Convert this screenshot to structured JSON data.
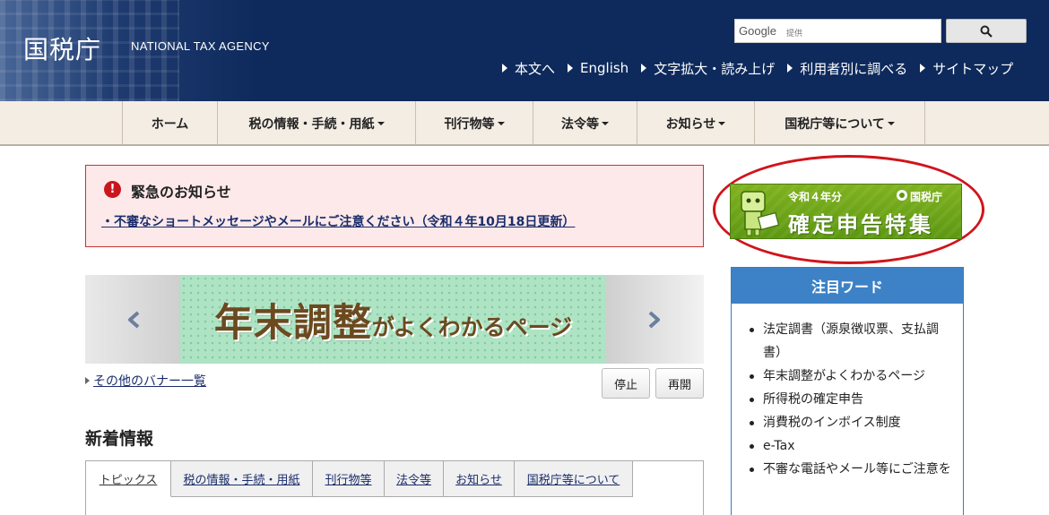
{
  "header": {
    "logo_jp": "国税庁",
    "logo_en": "NATIONAL TAX AGENCY",
    "search": {
      "brand": "Google",
      "brand_sub": "提供",
      "placeholder": "",
      "button_icon": "search-icon"
    },
    "utility_links": [
      {
        "label": "本文へ"
      },
      {
        "label": "English"
      },
      {
        "label": "文字拡大・読み上げ"
      },
      {
        "label": "利用者別に調べる"
      },
      {
        "label": "サイトマップ"
      }
    ]
  },
  "nav": {
    "items": [
      {
        "label": "ホーム",
        "has_dropdown": false
      },
      {
        "label": "税の情報・手続・用紙",
        "has_dropdown": true
      },
      {
        "label": "刊行物等",
        "has_dropdown": true
      },
      {
        "label": "法令等",
        "has_dropdown": true
      },
      {
        "label": "お知らせ",
        "has_dropdown": true
      },
      {
        "label": "国税庁等について",
        "has_dropdown": true
      }
    ]
  },
  "emergency": {
    "icon": "!",
    "title": "緊急のお知らせ",
    "link": "・不審なショートメッセージやメールにご注意ください（令和４年10月18日更新）"
  },
  "kakutei_banner": {
    "year": "令和４年分",
    "agency": "国税庁",
    "title": "確定申告特集"
  },
  "carousel": {
    "banner_main": "年末調整",
    "banner_sub": "がよくわかるページ",
    "other_banners_link": "その他のバナー一覧",
    "stop_label": "停止",
    "resume_label": "再開"
  },
  "news": {
    "title": "新着情報",
    "tabs": [
      {
        "label": "トピックス",
        "active": true
      },
      {
        "label": "税の情報・手続・用紙",
        "active": false
      },
      {
        "label": "刊行物等",
        "active": false
      },
      {
        "label": "法令等",
        "active": false
      },
      {
        "label": "お知らせ",
        "active": false
      },
      {
        "label": "国税庁等について",
        "active": false
      }
    ]
  },
  "keywords": {
    "title": "注目ワード",
    "items": [
      {
        "label": "法定調書（源泉徴収票、支払調書）"
      },
      {
        "label": "年末調整がよくわかるページ"
      },
      {
        "label": "所得税の確定申告"
      },
      {
        "label": "消費税のインボイス制度"
      },
      {
        "label": "e-Tax"
      },
      {
        "label": "不審な電話やメール等にご注意を"
      }
    ]
  },
  "colors": {
    "header_bg": "#0e2a5c",
    "nav_bg": "#f3ede4",
    "emergency_border": "#c73333",
    "emergency_bg": "#fde9e9",
    "keyword_head": "#3d82c6",
    "highlight_ellipse": "#d0141b",
    "kakutei_green": "#6fa51a"
  }
}
